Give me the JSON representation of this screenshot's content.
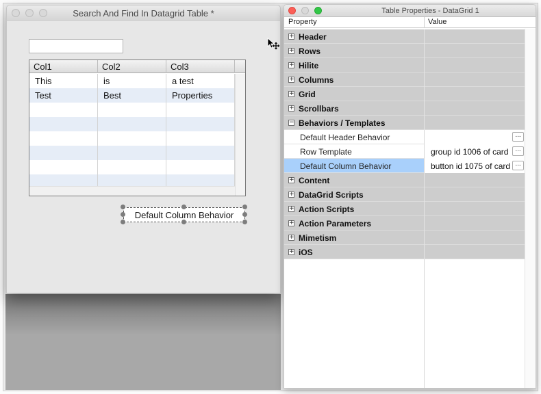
{
  "left_window": {
    "title": "Search And Find In Datagrid Table *",
    "search_value": "",
    "grid": {
      "columns": [
        "Col1",
        "Col2",
        "Col3"
      ],
      "rows": [
        [
          "This",
          "is",
          "a test"
        ],
        [
          "Test",
          "Best",
          "Properties"
        ],
        [
          "",
          "",
          ""
        ],
        [
          "",
          "",
          ""
        ],
        [
          "",
          "",
          ""
        ],
        [
          "",
          "",
          ""
        ],
        [
          "",
          "",
          ""
        ],
        [
          "",
          "",
          ""
        ]
      ]
    },
    "selected_button_label": "Default Column Behavior"
  },
  "right_window": {
    "title": "Table Properties - DataGrid 1",
    "col_property": "Property",
    "col_value": "Value",
    "rows": [
      {
        "kind": "section",
        "label": "Header",
        "expanded": false
      },
      {
        "kind": "section",
        "label": "Rows",
        "expanded": false
      },
      {
        "kind": "section",
        "label": "Hilite",
        "expanded": false
      },
      {
        "kind": "section",
        "label": "Columns",
        "expanded": false
      },
      {
        "kind": "section",
        "label": "Grid",
        "expanded": false
      },
      {
        "kind": "section",
        "label": "Scrollbars",
        "expanded": false
      },
      {
        "kind": "section",
        "label": "Behaviors / Templates",
        "expanded": true
      },
      {
        "kind": "item",
        "label": "Default Header Behavior",
        "value": "",
        "selected": false
      },
      {
        "kind": "item",
        "label": "Row Template",
        "value": "group id 1006 of card",
        "selected": false
      },
      {
        "kind": "item",
        "label": "Default Column Behavior",
        "value": "button id 1075 of card",
        "selected": true
      },
      {
        "kind": "section",
        "label": "Content",
        "expanded": false
      },
      {
        "kind": "section",
        "label": "DataGrid Scripts",
        "expanded": false
      },
      {
        "kind": "section",
        "label": "Action Scripts",
        "expanded": false
      },
      {
        "kind": "section",
        "label": "Action Parameters",
        "expanded": false
      },
      {
        "kind": "section",
        "label": "Mimetism",
        "expanded": false
      },
      {
        "kind": "section",
        "label": "iOS",
        "expanded": false
      }
    ],
    "edit_button_label": "...",
    "toggle_collapsed": "+",
    "toggle_expanded": "−"
  },
  "colors": {
    "selection": "#a9d0fb",
    "section_bg": "#cdcdcd",
    "grid_alt_row": "#e6edf7",
    "close": "#fc5f57",
    "minimize": "#fdbb2e",
    "zoom": "#33c748"
  },
  "icons": {
    "cursor": "move-cursor-icon"
  }
}
